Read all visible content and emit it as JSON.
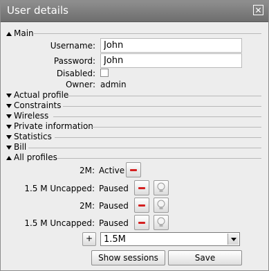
{
  "window": {
    "title": "User details",
    "close_glyph": "✕"
  },
  "sections": {
    "main": "Main",
    "actual_profile": "Actual profile",
    "constraints": "Constraints",
    "wireless": "Wireless",
    "private_information": "Private information",
    "statistics": "Statistics",
    "bill": "Bill",
    "all_profiles": "All profiles"
  },
  "main": {
    "username_label": "Username:",
    "username_value": "John",
    "password_label": "Password:",
    "password_value": "John",
    "disabled_label": "Disabled:",
    "disabled_checked": false,
    "owner_label": "Owner:",
    "owner_value": "admin"
  },
  "profiles": [
    {
      "name": "2M:",
      "status": "Active",
      "has_bulb": false
    },
    {
      "name": "1.5 M Uncapped:",
      "status": "Paused",
      "has_bulb": true
    },
    {
      "name": "2M:",
      "status": "Paused",
      "has_bulb": true
    },
    {
      "name": "1.5 M Uncapped:",
      "status": "Paused",
      "has_bulb": true
    }
  ],
  "add_profile": {
    "button_label": "+",
    "selected": "1.5M"
  },
  "actions": {
    "show_sessions": "Show sessions",
    "save": "Save"
  },
  "colors": {
    "titlebar": "#7a7a7a",
    "remove_accent": "#d42020"
  },
  "icons": {
    "remove": "minus-icon",
    "activate": "lightbulb-icon",
    "expanded": "triangle-up-icon",
    "collapsed": "triangle-down-icon"
  }
}
